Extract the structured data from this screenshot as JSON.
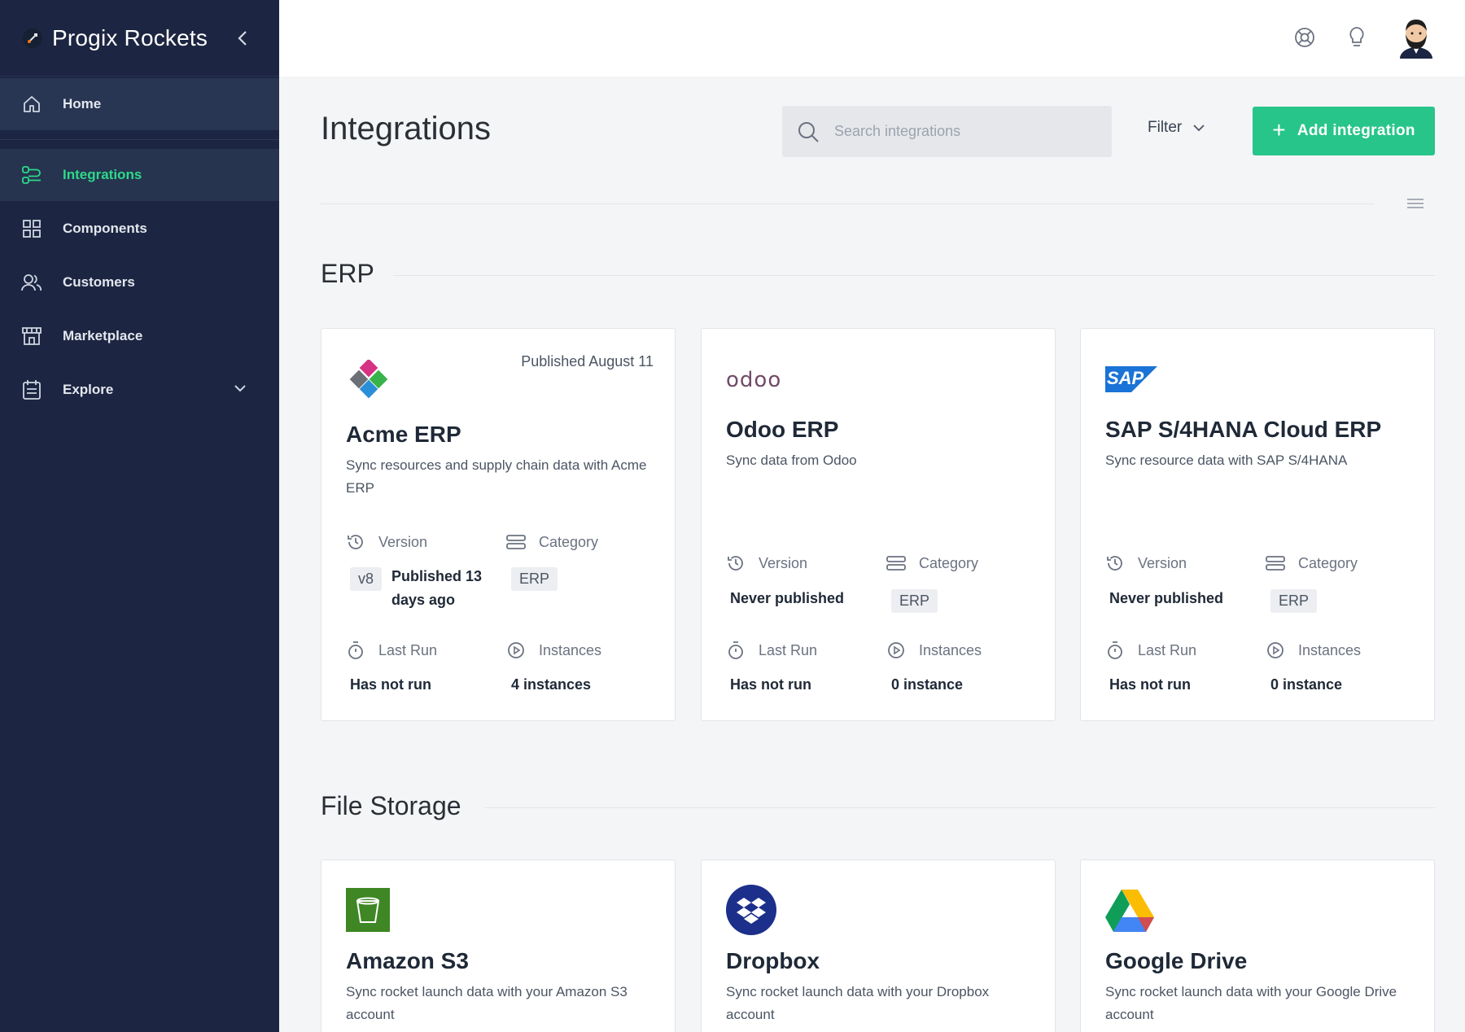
{
  "app": {
    "name": "Progix Rockets"
  },
  "sidebar": {
    "items": [
      {
        "label": "Home"
      },
      {
        "label": "Integrations"
      },
      {
        "label": "Components"
      },
      {
        "label": "Customers"
      },
      {
        "label": "Marketplace"
      },
      {
        "label": "Explore"
      }
    ],
    "active": "Integrations"
  },
  "header": {
    "title": "Integrations",
    "search_placeholder": "Search integrations",
    "filter_label": "Filter",
    "add_label": "Add integration"
  },
  "labels": {
    "version": "Version",
    "category": "Category",
    "last_run": "Last Run",
    "instances": "Instances"
  },
  "sections": [
    {
      "title": "ERP",
      "cards": [
        {
          "name": "Acme ERP",
          "published": "Published August 11",
          "description": "Sync resources and supply chain data with Acme ERP",
          "version_badge": "v8",
          "version_text": "Published 13 days ago",
          "category": "ERP",
          "last_run": "Has not run",
          "instances": "4 instances"
        },
        {
          "name": "Odoo ERP",
          "logo_text": "odoo",
          "description": "Sync data from Odoo",
          "version_text": "Never published",
          "category": "ERP",
          "last_run": "Has not run",
          "instances": "0 instance"
        },
        {
          "name": "SAP S/4HANA Cloud ERP",
          "logo_text": "SAP",
          "description": "Sync resource data with SAP S/4HANA",
          "version_text": "Never published",
          "category": "ERP",
          "last_run": "Has not run",
          "instances": "0 instance"
        }
      ]
    },
    {
      "title": "File Storage",
      "cards": [
        {
          "name": "Amazon S3",
          "description": "Sync rocket launch data with your Amazon S3 account"
        },
        {
          "name": "Dropbox",
          "description": "Sync rocket launch data with your Dropbox account"
        },
        {
          "name": "Google Drive",
          "description": "Sync rocket launch data with your Google Drive account"
        }
      ]
    }
  ],
  "colors": {
    "sidebar_bg": "#1c2541",
    "accent": "#27c58a",
    "active_text": "#2ed98a"
  }
}
